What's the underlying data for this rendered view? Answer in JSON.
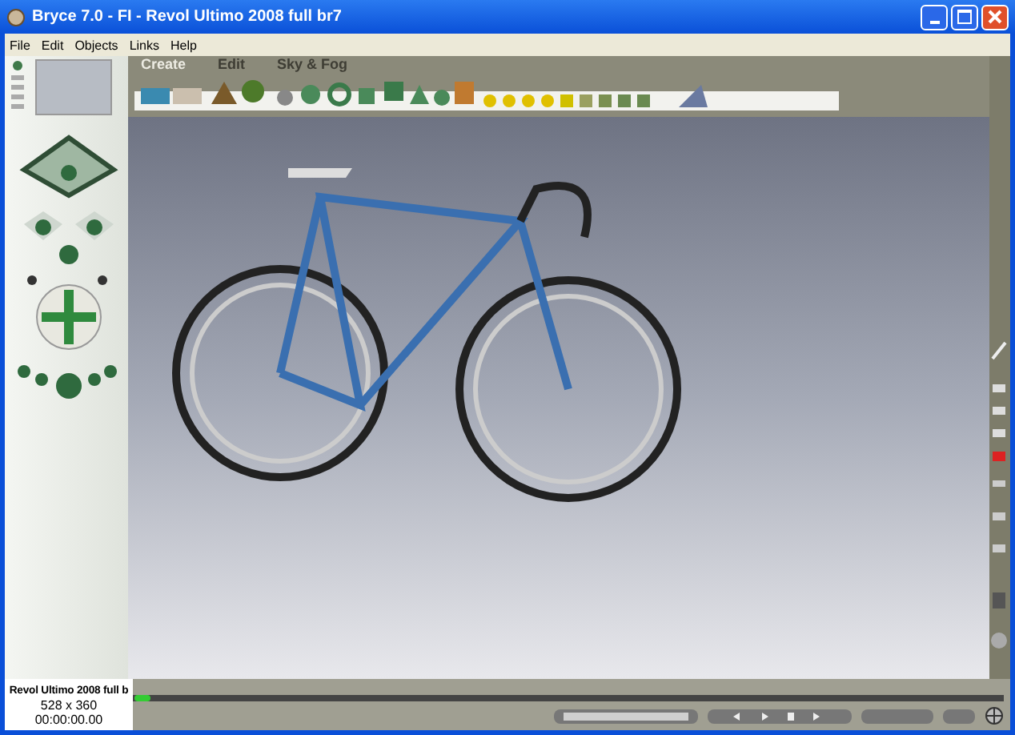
{
  "window": {
    "title": "Bryce 7.0 - FI - Revol Ultimo 2008 full br7"
  },
  "menu": [
    {
      "label": "File"
    },
    {
      "label": "Edit"
    },
    {
      "label": "Objects"
    },
    {
      "label": "Links"
    },
    {
      "label": "Help"
    }
  ],
  "tabs": [
    {
      "label": "Create",
      "selected": true
    },
    {
      "label": "Edit",
      "selected": false
    },
    {
      "label": "Sky & Fog",
      "selected": false
    }
  ],
  "status": {
    "scene_name": "Revol Ultimo 2008 full b",
    "size": "528 x 360",
    "time": "00:00:00.00"
  }
}
